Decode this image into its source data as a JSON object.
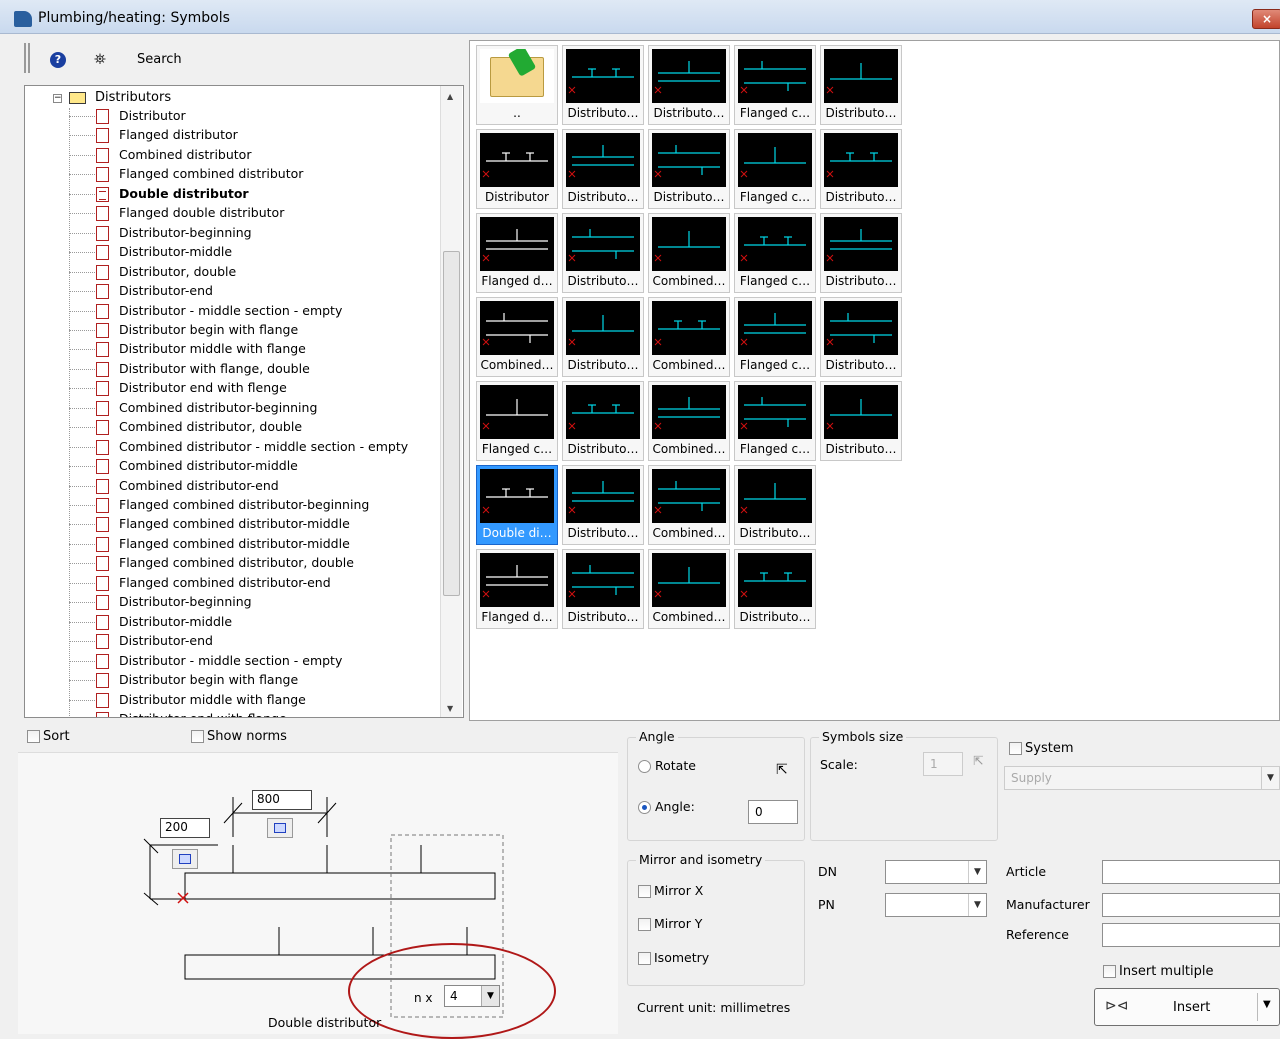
{
  "window": {
    "title": "Plumbing/heating: Symbols",
    "close": "×"
  },
  "toolbar": {
    "help": "?",
    "search": "Search"
  },
  "tree": {
    "root": "Distributors",
    "items": [
      "Distributor",
      "Flanged distributor",
      "Combined distributor",
      "Flanged combined distributor",
      "Double distributor",
      "Flanged double distributor",
      "Distributor-beginning",
      "Distributor-middle",
      "Distributor, double",
      "Distributor-end",
      "Distributor - middle section - empty",
      "Distributor begin with flange",
      "Distributor middle with flange",
      "Distributor with flange, double",
      "Distributor end with flenge",
      "Combined distributor-beginning",
      "Combined distributor, double",
      "Combined distributor - middle section - empty",
      "Combined distributor-middle",
      "Combined distributor-end",
      "Flanged combined distributor-beginning",
      "Flanged combined distributor-middle",
      "Flanged combined distributor-middle",
      "Flanged combined distributor, double",
      "Flanged combined distributor-end",
      "Distributor-beginning",
      "Distributor-middle",
      "Distributor-end",
      "Distributor - middle section - empty",
      "Distributor begin with flange",
      "Distributor middle with flange",
      "Distributor end with flange"
    ],
    "selected_index": 4
  },
  "grid": {
    "rows": [
      [
        "..",
        "Distributo…",
        "Distributo…",
        "Flanged c…",
        "Distributo…"
      ],
      [
        "Distributor",
        "Distributo…",
        "Distributo…",
        "Flanged c…",
        "Distributo…"
      ],
      [
        "Flanged d…",
        "Distributo…",
        "Combined…",
        "Flanged c…",
        "Distributo…"
      ],
      [
        "Combined…",
        "Distributo…",
        "Combined…",
        "Flanged c…",
        "Distributo…"
      ],
      [
        "Flanged c…",
        "Distributo…",
        "Combined…",
        "Flanged c…",
        "Distributo…"
      ],
      [
        "Double di…",
        "Distributo…",
        "Combined…",
        "Distributo…"
      ],
      [
        "Flanged d…",
        "Distributo…",
        "Combined…",
        "Distributo…"
      ]
    ],
    "selected": "Double di…"
  },
  "options": {
    "sort": "Sort",
    "show_norms": "Show norms"
  },
  "preview": {
    "width_value": "800",
    "height_value": "200",
    "nx_label": "n x",
    "nx_value": "4",
    "caption": "Double distributor"
  },
  "angle": {
    "title": "Angle",
    "rotate": "Rotate",
    "angle_label": "Angle:",
    "angle_value": "0"
  },
  "symbols_size": {
    "title": "Symbols size",
    "scale_label": "Scale:",
    "scale_value": "1"
  },
  "system": {
    "label": "System",
    "value": "Supply"
  },
  "mirror": {
    "title": "Mirror and isometry",
    "mirror_x": "Mirror X",
    "mirror_y": "Mirror Y",
    "isometry": "Isometry"
  },
  "dn_label": "DN",
  "pn_label": "PN",
  "article_label": "Article",
  "manufacturer_label": "Manufacturer",
  "reference_label": "Reference",
  "insert_multiple": "Insert multiple",
  "insert_label": "Insert",
  "current_unit": "Current unit: millimetres",
  "colors": {
    "symbol_line": "#00d8e8",
    "selection": "#3399ff",
    "marker": "#d01010"
  }
}
